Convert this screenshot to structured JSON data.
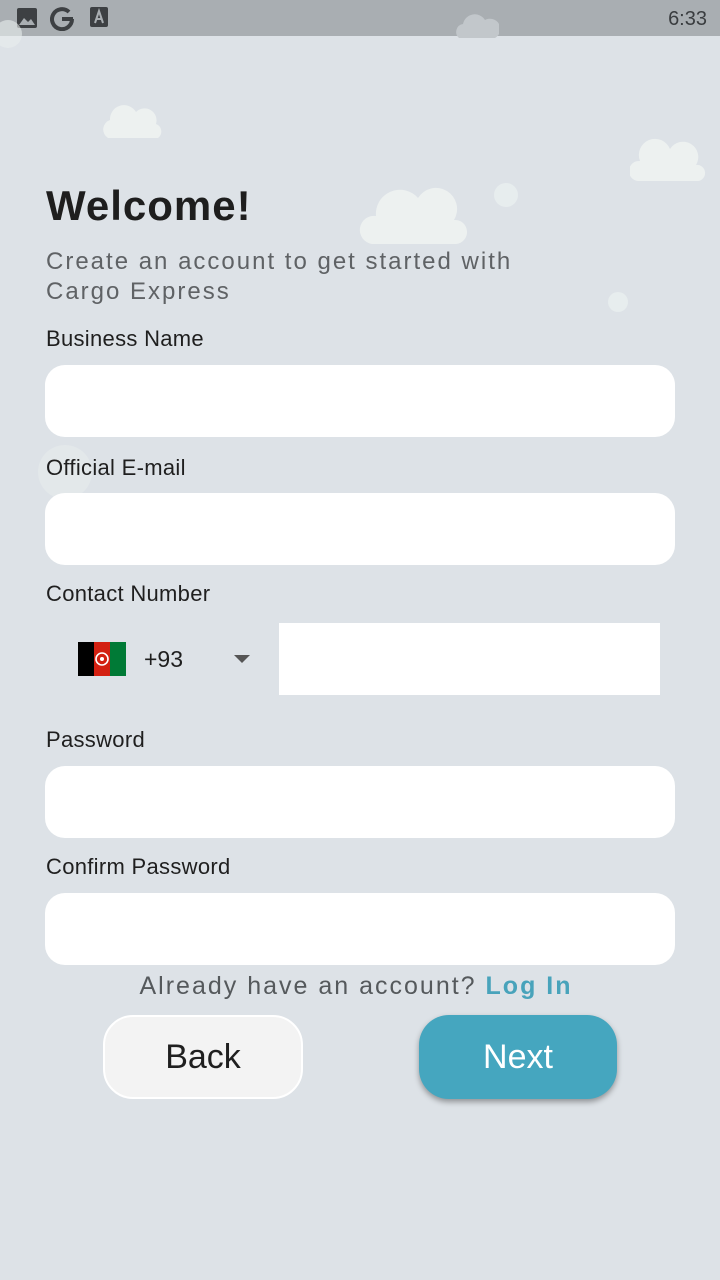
{
  "status_bar": {
    "time": "6:33",
    "icons": [
      "image-icon",
      "google-icon",
      "font-icon"
    ]
  },
  "header": {
    "title": "Welcome!",
    "subtitle": "Create an account to get started with Cargo Express"
  },
  "form": {
    "business_name": {
      "label": "Business Name",
      "value": "",
      "placeholder": ""
    },
    "email": {
      "label": "Official E-mail",
      "value": "",
      "placeholder": ""
    },
    "contact": {
      "label": "Contact Number",
      "country_flag": "afghanistan-flag-icon",
      "dial_code": "+93",
      "value": "",
      "placeholder": ""
    },
    "password": {
      "label": "Password",
      "value": "",
      "placeholder": ""
    },
    "confirm_password": {
      "label": "Confirm Password",
      "value": "",
      "placeholder": ""
    }
  },
  "login_prompt": {
    "text": "Already have an account?",
    "link": "Log In"
  },
  "buttons": {
    "back": "Back",
    "next": "Next"
  },
  "colors": {
    "background": "#dde2e7",
    "accent": "#45a6bf",
    "link": "#48a3bb",
    "status_bar": "#a9aeb2"
  }
}
